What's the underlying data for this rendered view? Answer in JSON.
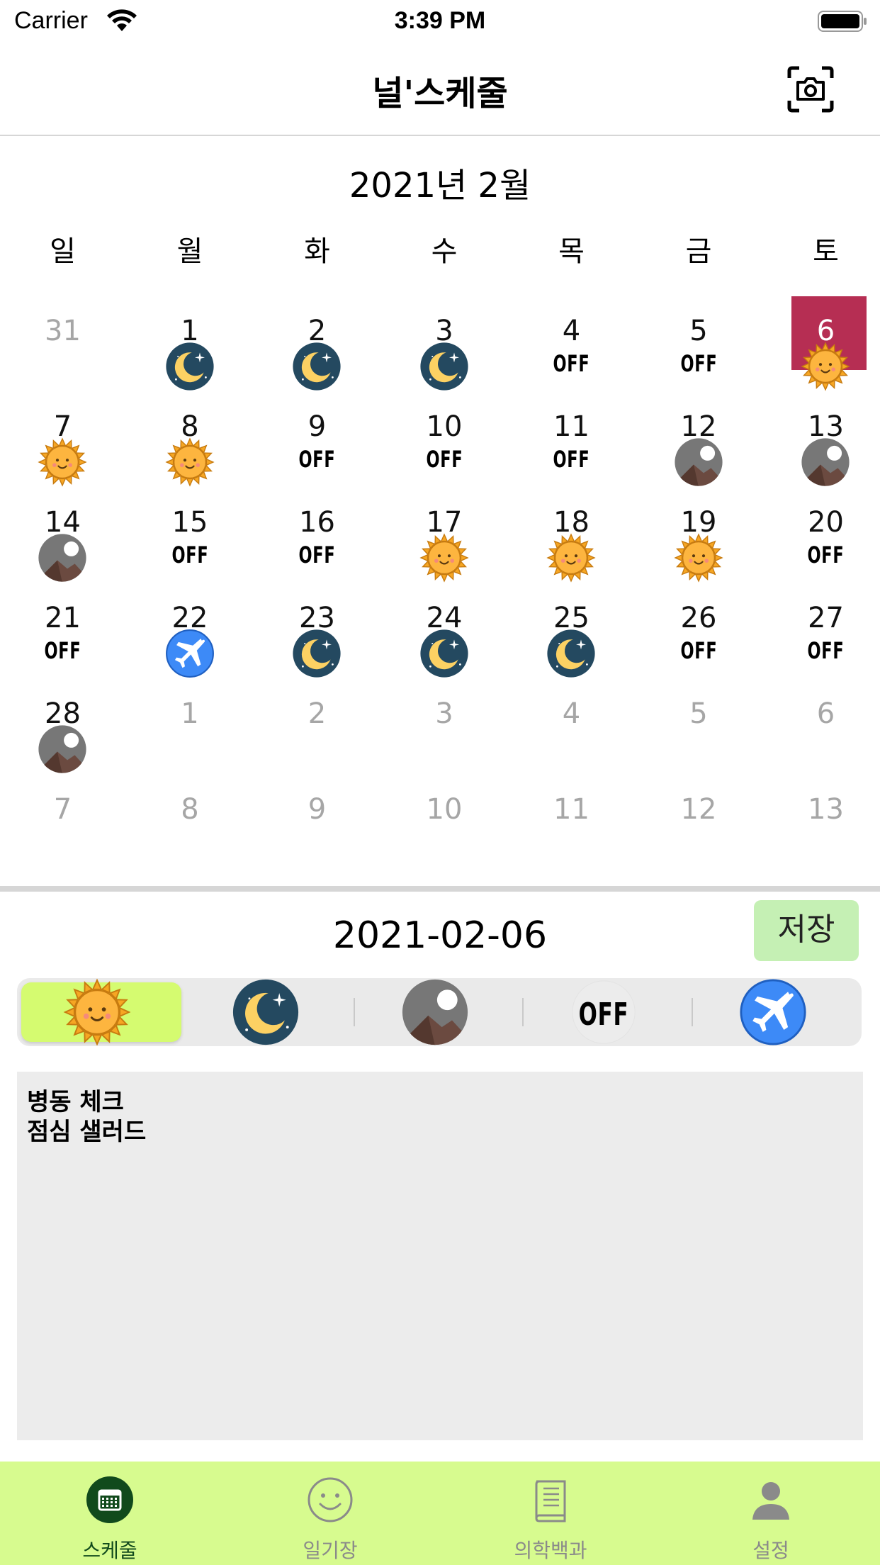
{
  "status_bar": {
    "carrier": "Carrier",
    "time": "3:39 PM"
  },
  "nav": {
    "title": "널'스케줄",
    "camera_icon": "camera-scan-icon"
  },
  "calendar": {
    "month_title": "2021년 2월",
    "weekdays": [
      "일",
      "월",
      "화",
      "수",
      "목",
      "금",
      "토"
    ],
    "days": [
      {
        "d": "31",
        "other": true,
        "shift": ""
      },
      {
        "d": "1",
        "shift": "night"
      },
      {
        "d": "2",
        "shift": "night"
      },
      {
        "d": "3",
        "shift": "night"
      },
      {
        "d": "4",
        "shift": "off"
      },
      {
        "d": "5",
        "shift": "off"
      },
      {
        "d": "6",
        "shift": "day",
        "selected": true
      },
      {
        "d": "7",
        "shift": "day"
      },
      {
        "d": "8",
        "shift": "day"
      },
      {
        "d": "9",
        "shift": "off"
      },
      {
        "d": "10",
        "shift": "off"
      },
      {
        "d": "11",
        "shift": "off"
      },
      {
        "d": "12",
        "shift": "evening"
      },
      {
        "d": "13",
        "shift": "evening"
      },
      {
        "d": "14",
        "shift": "evening"
      },
      {
        "d": "15",
        "shift": "off"
      },
      {
        "d": "16",
        "shift": "off"
      },
      {
        "d": "17",
        "shift": "day"
      },
      {
        "d": "18",
        "shift": "day"
      },
      {
        "d": "19",
        "shift": "day"
      },
      {
        "d": "20",
        "shift": "off"
      },
      {
        "d": "21",
        "shift": "off"
      },
      {
        "d": "22",
        "shift": "vacation"
      },
      {
        "d": "23",
        "shift": "night"
      },
      {
        "d": "24",
        "shift": "night"
      },
      {
        "d": "25",
        "shift": "night"
      },
      {
        "d": "26",
        "shift": "off"
      },
      {
        "d": "27",
        "shift": "off"
      },
      {
        "d": "28",
        "shift": "evening"
      },
      {
        "d": "1",
        "other": true,
        "shift": ""
      },
      {
        "d": "2",
        "other": true,
        "shift": ""
      },
      {
        "d": "3",
        "other": true,
        "shift": ""
      },
      {
        "d": "4",
        "other": true,
        "shift": ""
      },
      {
        "d": "5",
        "other": true,
        "shift": ""
      },
      {
        "d": "6",
        "other": true,
        "shift": ""
      },
      {
        "d": "7",
        "other": true,
        "shift": ""
      },
      {
        "d": "8",
        "other": true,
        "shift": ""
      },
      {
        "d": "9",
        "other": true,
        "shift": ""
      },
      {
        "d": "10",
        "other": true,
        "shift": ""
      },
      {
        "d": "11",
        "other": true,
        "shift": ""
      },
      {
        "d": "12",
        "other": true,
        "shift": ""
      },
      {
        "d": "13",
        "other": true,
        "shift": ""
      }
    ],
    "off_label": "OFF"
  },
  "detail": {
    "date": "2021-02-06",
    "save_label": "저장",
    "shift_options": [
      "day",
      "night",
      "evening",
      "off",
      "vacation"
    ],
    "selected_shift": "day",
    "memo": "병동 체크\n점심 샐러드"
  },
  "colors": {
    "selected_day": "#b62e53",
    "tabbar": "#d7fb8f",
    "active_segment": "#d5fb70",
    "save_button": "#c5f0b4"
  },
  "tabs": [
    {
      "label": "스케줄",
      "icon": "calendar-icon",
      "active": true
    },
    {
      "label": "일기장",
      "icon": "smiley-icon",
      "active": false
    },
    {
      "label": "의학백과",
      "icon": "book-icon",
      "active": false
    },
    {
      "label": "설정",
      "icon": "person-icon",
      "active": false
    }
  ]
}
